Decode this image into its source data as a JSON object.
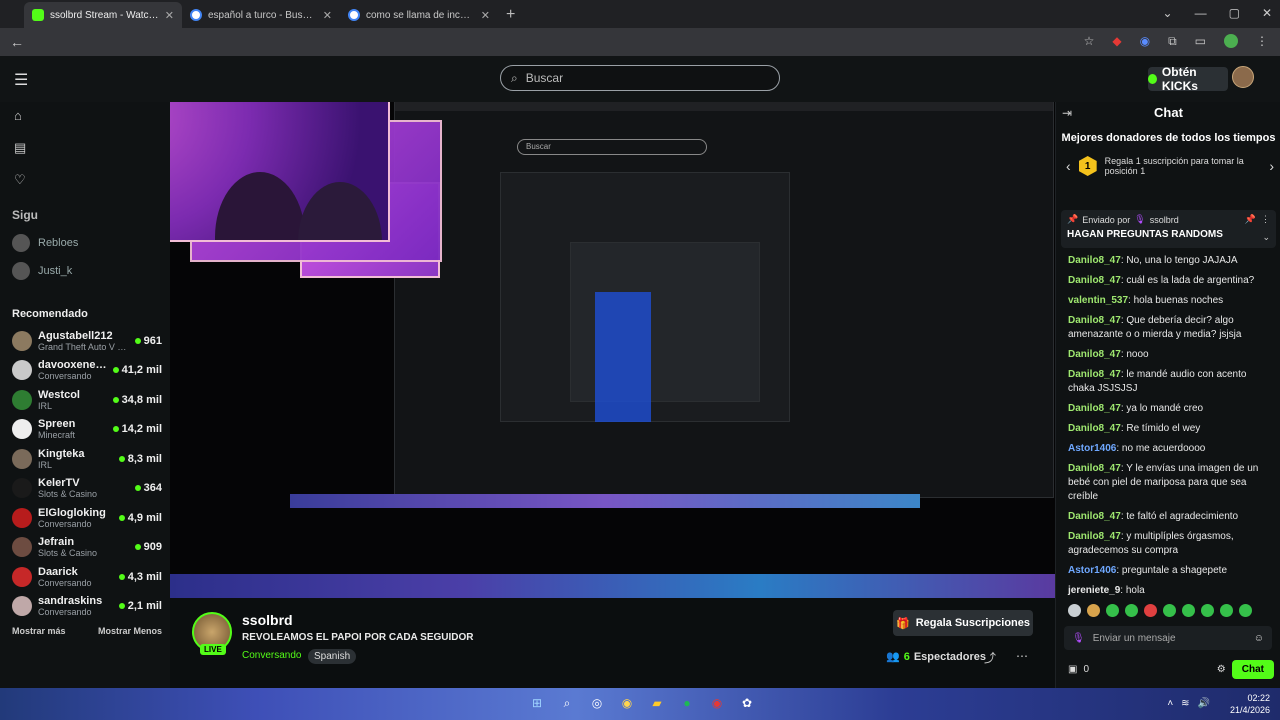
{
  "browser": {
    "tabs": [
      {
        "title": "ssolbrd Stream - Watch Live on",
        "color": "#53fc18",
        "active": true
      },
      {
        "title": "español a turco - Buscar con G",
        "color": "#4285f4",
        "active": false
      },
      {
        "title": "como se llama de incognito ar",
        "color": "#4285f4",
        "active": false
      }
    ],
    "newtab": "+"
  },
  "header": {
    "search_placeholder": "Buscar",
    "kicks_label": "Obtén KICKs"
  },
  "sidebar": {
    "following_label": "Sigu",
    "following": [
      {
        "name": "Rebloes"
      },
      {
        "name": "Justi_k"
      }
    ],
    "recommended_title": "Recomendado",
    "recommended": [
      {
        "name": "Agustabell212",
        "category": "Grand Theft Auto V (G...",
        "viewers": "961",
        "color": "#8c7a60"
      },
      {
        "name": "davooxeneize",
        "category": "Conversando",
        "viewers": "41,2 mil",
        "color": "#c9c9c9"
      },
      {
        "name": "Westcol",
        "category": "IRL",
        "viewers": "34,8 mil",
        "color": "#2e7d32"
      },
      {
        "name": "Spreen",
        "category": "Minecraft",
        "viewers": "14,2 mil",
        "color": "#eeeeee"
      },
      {
        "name": "Kingteka",
        "category": "IRL",
        "viewers": "8,3 mil",
        "color": "#7a6a5a"
      },
      {
        "name": "KelerTV",
        "category": "Slots & Casino",
        "viewers": "364",
        "color": "#1a1a1a"
      },
      {
        "name": "ElGlogloking",
        "category": "Conversando",
        "viewers": "4,9 mil",
        "color": "#b71c1c"
      },
      {
        "name": "Jefrain",
        "category": "Slots & Casino",
        "viewers": "909",
        "color": "#6d4c41"
      },
      {
        "name": "Daarick",
        "category": "Conversando",
        "viewers": "4,3 mil",
        "color": "#c62828"
      },
      {
        "name": "sandraskins",
        "category": "Conversando",
        "viewers": "2,1 mil",
        "color": "#bfa8a8"
      }
    ],
    "show_more": "Mostrar más",
    "show_less": "Mostrar Menos"
  },
  "player": {
    "nested_search": "Buscar"
  },
  "stream": {
    "name": "ssolbrd",
    "live_badge": "LIVE",
    "title": "REVOLEAMOS EL PAPOI POR CADA SEGUIDOR",
    "category": "Conversando",
    "language": "Spanish",
    "gift_label": "Regala Suscripciones",
    "viewers_count": "6",
    "viewers_label": "Espectadores"
  },
  "chat": {
    "title": "Chat",
    "top_donors_title": "Mejores donadores de todos los tiempos",
    "donor_badge": "1",
    "donor_text": "Regala 1 suscripción para tomar la posición 1",
    "pinned_by_label": "Enviado por",
    "pinned_by_user": "ssolbrd",
    "pinned_message": "HAGAN PREGUNTAS RANDOMS",
    "messages": [
      {
        "user": "Danilo8_47",
        "text": "No, una lo tengo JAJAJA",
        "color": "green"
      },
      {
        "user": "Danilo8_47",
        "text": "cuál es la lada de argentina?",
        "color": "green"
      },
      {
        "user": "valentin_537",
        "text": "hola buenas noches",
        "color": "green"
      },
      {
        "user": "Danilo8_47",
        "text": "Que debería decir? algo amenazante o o mierda y media? jsjsja",
        "color": "green"
      },
      {
        "user": "Danilo8_47",
        "text": "nooo",
        "color": "green"
      },
      {
        "user": "Danilo8_47",
        "text": "le mandé audio con acento chaka JSJSJSJ",
        "color": "green"
      },
      {
        "user": "Danilo8_47",
        "text": "ya lo mandé creo",
        "color": "green"
      },
      {
        "user": "Danilo8_47",
        "text": "Re tímido el wey",
        "color": "green"
      },
      {
        "user": "Astor1406",
        "text": "no me acuerdoooo",
        "color": "blue"
      },
      {
        "user": "Danilo8_47",
        "text": "Y le envías una imagen de un bebé con piel de mariposa para que sea creíble",
        "color": "green"
      },
      {
        "user": "Danilo8_47",
        "text": "te faltó el agradecimiento",
        "color": "green"
      },
      {
        "user": "Danilo8_47",
        "text": "y multiplíples órgasmos, agradecemos su compra",
        "color": "green"
      },
      {
        "user": "Astor1406",
        "text": "preguntale a shagepete",
        "color": "blue"
      },
      {
        "user": "jereniete_9",
        "text": "hola",
        "color": "white"
      }
    ],
    "input_placeholder": "Enviar un mensaje",
    "points": "0",
    "send_label": "Chat"
  },
  "taskbar": {
    "time": "02:22",
    "date": "21/4/2026"
  }
}
